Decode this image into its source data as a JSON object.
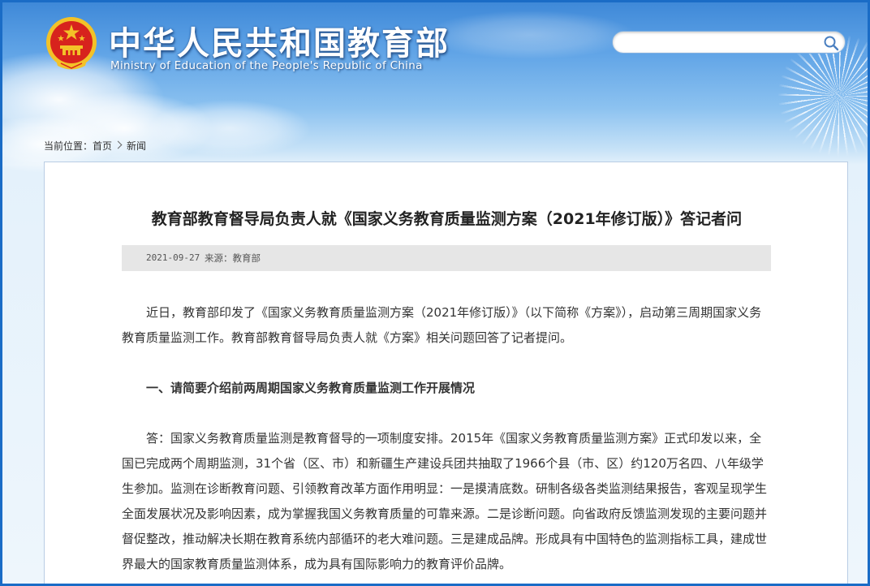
{
  "header": {
    "title_cn": "中华人民共和国教育部",
    "title_en": "Ministry of Education of the People's Republic of China",
    "search_placeholder": ""
  },
  "breadcrumb": {
    "label": "当前位置：",
    "items": [
      "首页",
      "新闻"
    ]
  },
  "article": {
    "title": "教育部教育督导局负责人就《国家义务教育质量监测方案（2021年修订版）》答记者问",
    "date": "2021-09-27",
    "source": "来源：教育部",
    "paragraphs": [
      "近日，教育部印发了《国家义务教育质量监测方案（2021年修订版）》（以下简称《方案》），启动第三周期国家义务教育质量监测工作。教育部教育督导局负责人就《方案》相关问题回答了记者提问。",
      "一、请简要介绍前两周期国家义务教育质量监测工作开展情况",
      "答：国家义务教育质量监测是教育督导的一项制度安排。2015年《国家义务教育质量监测方案》正式印发以来，全国已完成两个周期监测，31个省（区、市）和新疆生产建设兵团共抽取了1966个县（市、区）约120万名四、八年级学生参加。监测在诊断教育问题、引领教育改革方面作用明显：一是摸清底数。研制各级各类监测结果报告，客观呈现学生全面发展状况及影响因素，成为掌握我国义务教育质量的可靠来源。二是诊断问题。向省政府反馈监测发现的主要问题并督促整改，推动解决长期在教育系统内部循环的老大难问题。三是建成品牌。形成具有中国特色的监测指标工具，建成世界最大的国家教育质量监测体系，成为具有国际影响力的教育评价品牌。"
    ]
  },
  "colors": {
    "frame_border": "#1a6cc6",
    "emblem_red": "#d7231d",
    "emblem_gold": "#f3c228"
  },
  "icons": {
    "search": "magnifier-icon",
    "emblem": "national-emblem-icon",
    "breadcrumb_separator": "chevron-right-icon"
  }
}
